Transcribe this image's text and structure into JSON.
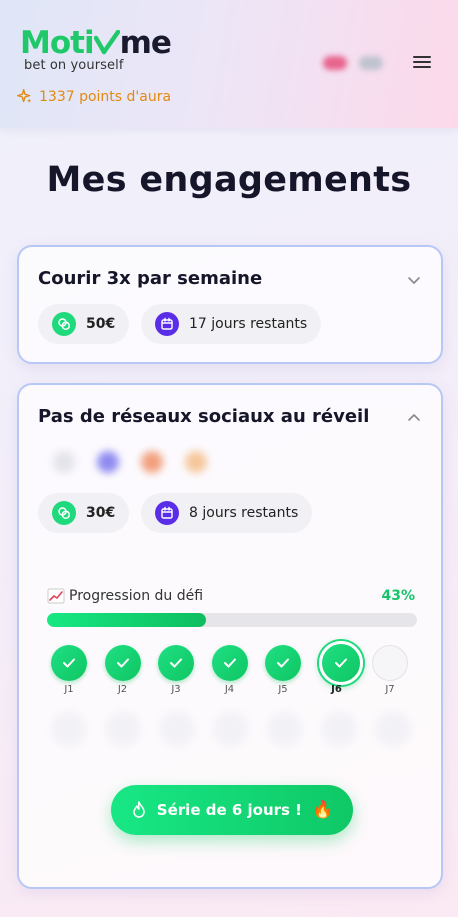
{
  "header": {
    "brand_part1": "Moti",
    "brand_part2": "me",
    "tagline": "bet on yourself",
    "aura": "1337 points d'aura"
  },
  "page_title": "Mes engagements",
  "cards": [
    {
      "title": "Courir 3x par semaine",
      "stake": "50€",
      "remaining": "17 jours restants",
      "expanded": false
    },
    {
      "title": "Pas de réseaux sociaux au réveil",
      "stake": "30€",
      "remaining": "8 jours restants",
      "expanded": true,
      "progress": {
        "label": "Progression du défi",
        "percent_text": "43%",
        "percent": 43
      },
      "days": [
        {
          "label": "J1",
          "status": "done"
        },
        {
          "label": "J2",
          "status": "done"
        },
        {
          "label": "J3",
          "status": "done"
        },
        {
          "label": "J4",
          "status": "done"
        },
        {
          "label": "J5",
          "status": "done"
        },
        {
          "label": "J6",
          "status": "today"
        },
        {
          "label": "J7",
          "status": "todo"
        }
      ],
      "streak_label": "Série de 6 jours !",
      "streak_emoji": "🔥"
    }
  ],
  "colors": {
    "accent_green": "#1fd97d",
    "calendar_purple": "#5a2ee8",
    "aura_orange": "#e08a12"
  }
}
